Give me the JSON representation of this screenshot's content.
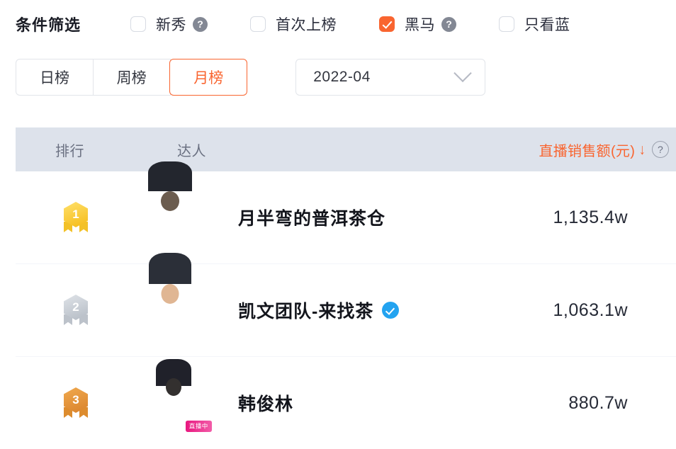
{
  "filters": {
    "title": "条件筛选",
    "checkboxes": [
      {
        "label": "新秀",
        "checked": false,
        "help": "?",
        "has_help": true
      },
      {
        "label": "首次上榜",
        "checked": false,
        "has_help": false
      },
      {
        "label": "黑马",
        "checked": true,
        "help": "?",
        "has_help": true
      },
      {
        "label": "只看蓝",
        "checked": false,
        "has_help": false
      }
    ]
  },
  "controls": {
    "tabs": [
      {
        "label": "日榜",
        "active": false
      },
      {
        "label": "周榜",
        "active": false
      },
      {
        "label": "月榜",
        "active": true
      }
    ],
    "date_select": {
      "value": "2022-04",
      "chevron": "chevron-down-icon"
    }
  },
  "table": {
    "headers": {
      "rank": "排行",
      "name": "达人",
      "value": "直播销售额(元)",
      "sort_arrow": "↓",
      "help": "?"
    },
    "rows": [
      {
        "rank": "1",
        "medal": "gold",
        "name": "月半弯的普洱茶仓",
        "verified": false,
        "live": false,
        "live_label": "",
        "value": "1,135.4w"
      },
      {
        "rank": "2",
        "medal": "silver",
        "name": "凯文团队-来找茶",
        "verified": true,
        "live": false,
        "live_label": "",
        "value": "1,063.1w"
      },
      {
        "rank": "3",
        "medal": "bronze",
        "name": "韩俊林",
        "verified": false,
        "live": true,
        "live_label": "直播中",
        "value": "880.7w"
      }
    ]
  },
  "colors": {
    "accent": "#f96530",
    "header_bg": "#dde2eb",
    "verified_blue": "#23a3f0",
    "live_pink": "#e8177f"
  }
}
